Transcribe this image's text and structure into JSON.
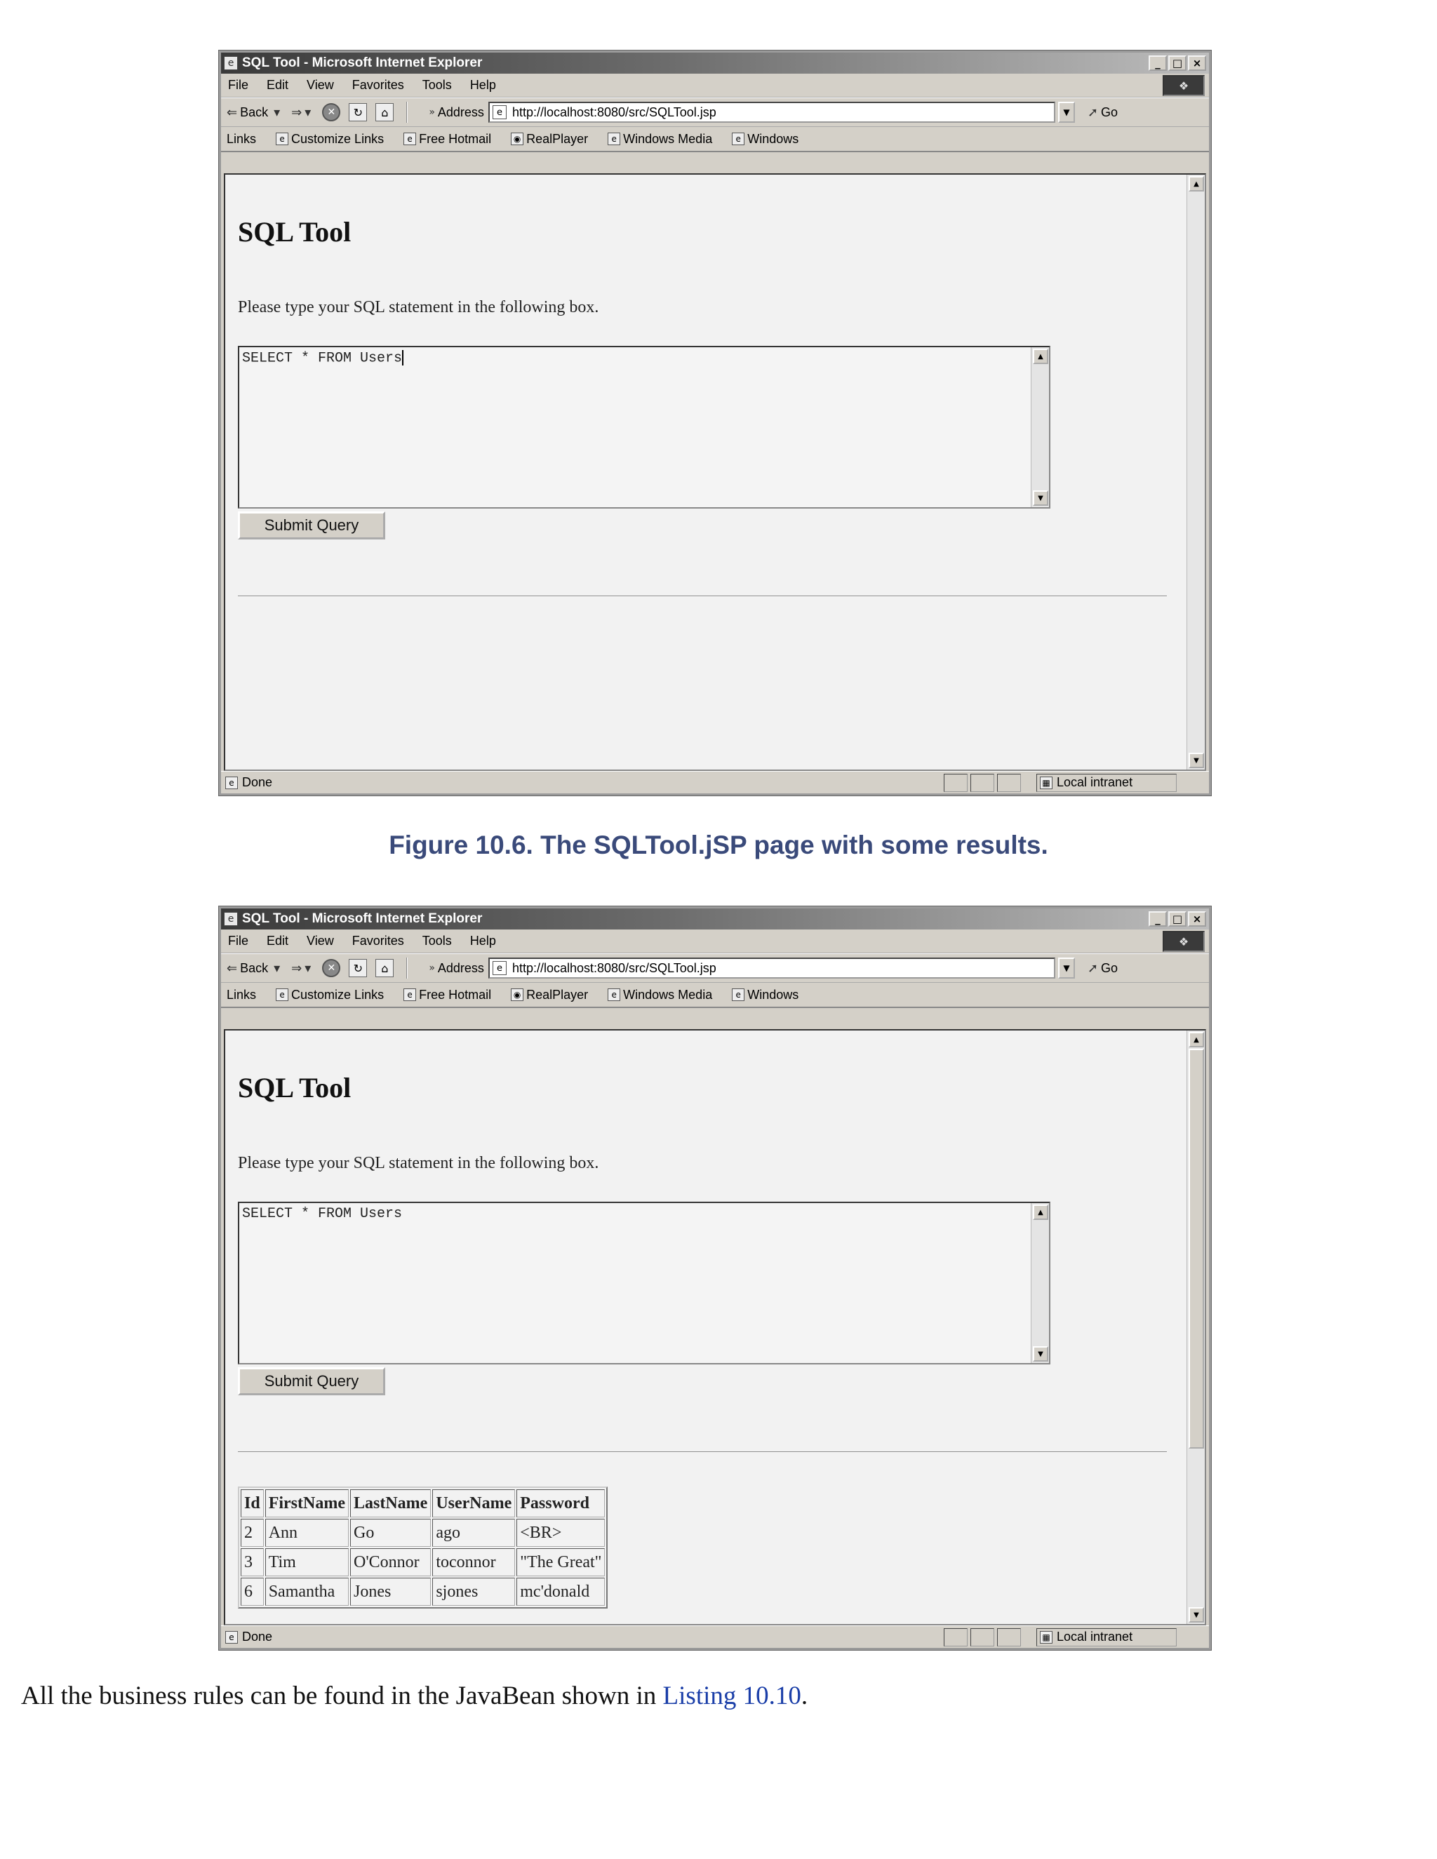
{
  "browser": {
    "title": "SQL Tool - Microsoft Internet Explorer",
    "title_buttons": [
      "_",
      "□",
      "×"
    ],
    "menu": [
      "File",
      "Edit",
      "View",
      "Favorites",
      "Tools",
      "Help"
    ],
    "toolbar": {
      "back": "Back",
      "address_label": "Address",
      "url": "http://localhost:8080/src/SQLTool.jsp",
      "go": "Go"
    },
    "links": [
      "Links",
      "Customize Links",
      "Free Hotmail",
      "RealPlayer",
      "Windows Media",
      "Windows"
    ],
    "status": {
      "left": "Done",
      "zone": "Local intranet"
    }
  },
  "page": {
    "heading": "SQL Tool",
    "prompt": "Please type your SQL statement in the following box.",
    "query": "SELECT * FROM Users",
    "submit_label": "Submit Query"
  },
  "caption": "Figure 10.6. The SQLTool.jSP page with some results.",
  "results": {
    "headers": [
      "Id",
      "FirstName",
      "LastName",
      "UserName",
      "Password"
    ],
    "rows": [
      [
        "2",
        "Ann",
        "Go",
        "ago",
        "<BR>"
      ],
      [
        "3",
        "Tim",
        "O'Connor",
        "toconnor",
        "\"The Great\""
      ],
      [
        "6",
        "Samantha",
        "Jones",
        "sjones",
        "mc'donald"
      ]
    ]
  },
  "body": {
    "text": "All the business rules can be found in the JavaBean shown in ",
    "link": "Listing 10.10",
    "end": "."
  }
}
